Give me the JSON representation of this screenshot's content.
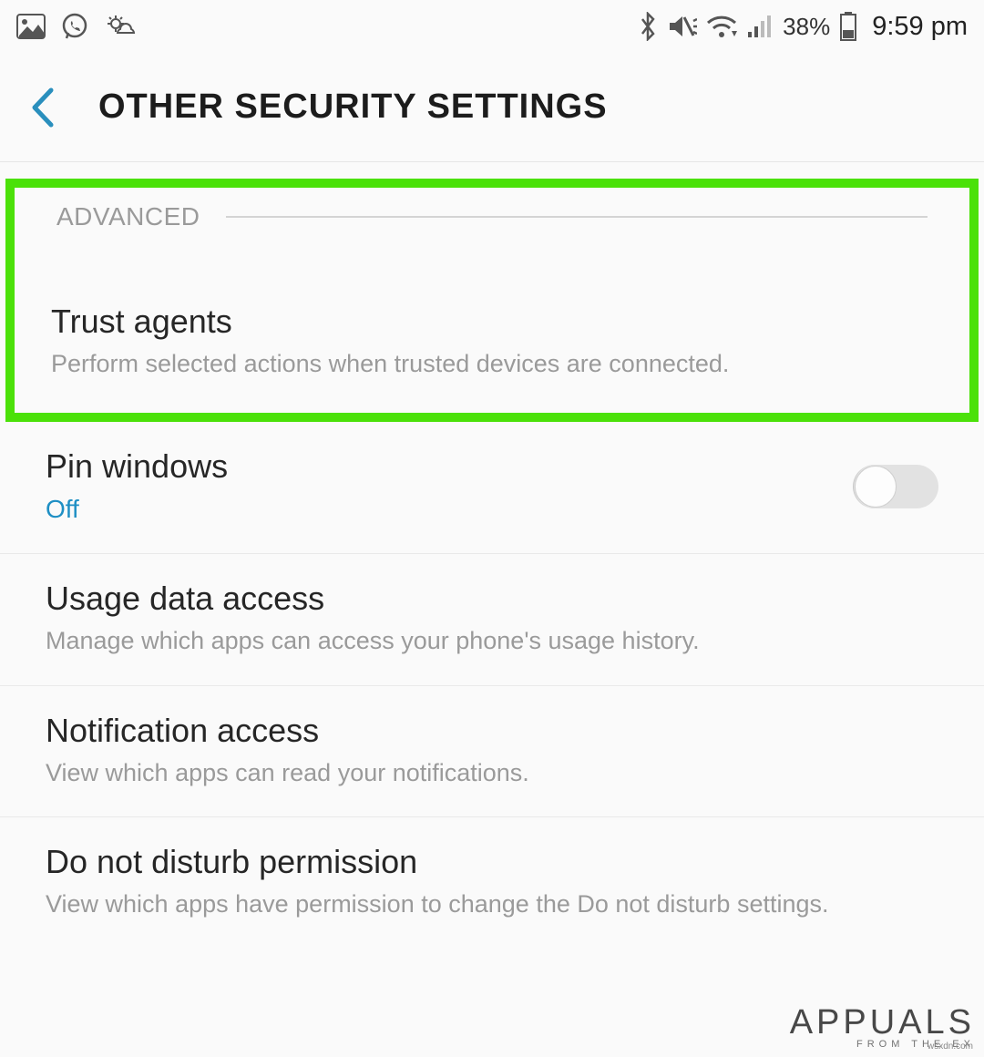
{
  "status_bar": {
    "battery_percent": "38%",
    "time": "9:59 pm"
  },
  "app_bar": {
    "title": "OTHER SECURITY SETTINGS"
  },
  "section": {
    "label": "ADVANCED"
  },
  "settings": {
    "trust_agents": {
      "title": "Trust agents",
      "subtitle": "Perform selected actions when trusted devices are connected."
    },
    "pin_windows": {
      "title": "Pin windows",
      "state": "Off",
      "toggle_on": false
    },
    "usage_data": {
      "title": "Usage data access",
      "subtitle": "Manage which apps can access your phone's usage history."
    },
    "notification_access": {
      "title": "Notification access",
      "subtitle": "View which apps can read your notifications."
    },
    "dnd_permission": {
      "title": "Do not disturb permission",
      "subtitle": "View which apps have permission to change the Do not disturb settings."
    }
  },
  "watermark": {
    "brand": "APPUALS",
    "tagline": "FROM THE EX",
    "source": "wsxdn.com"
  }
}
